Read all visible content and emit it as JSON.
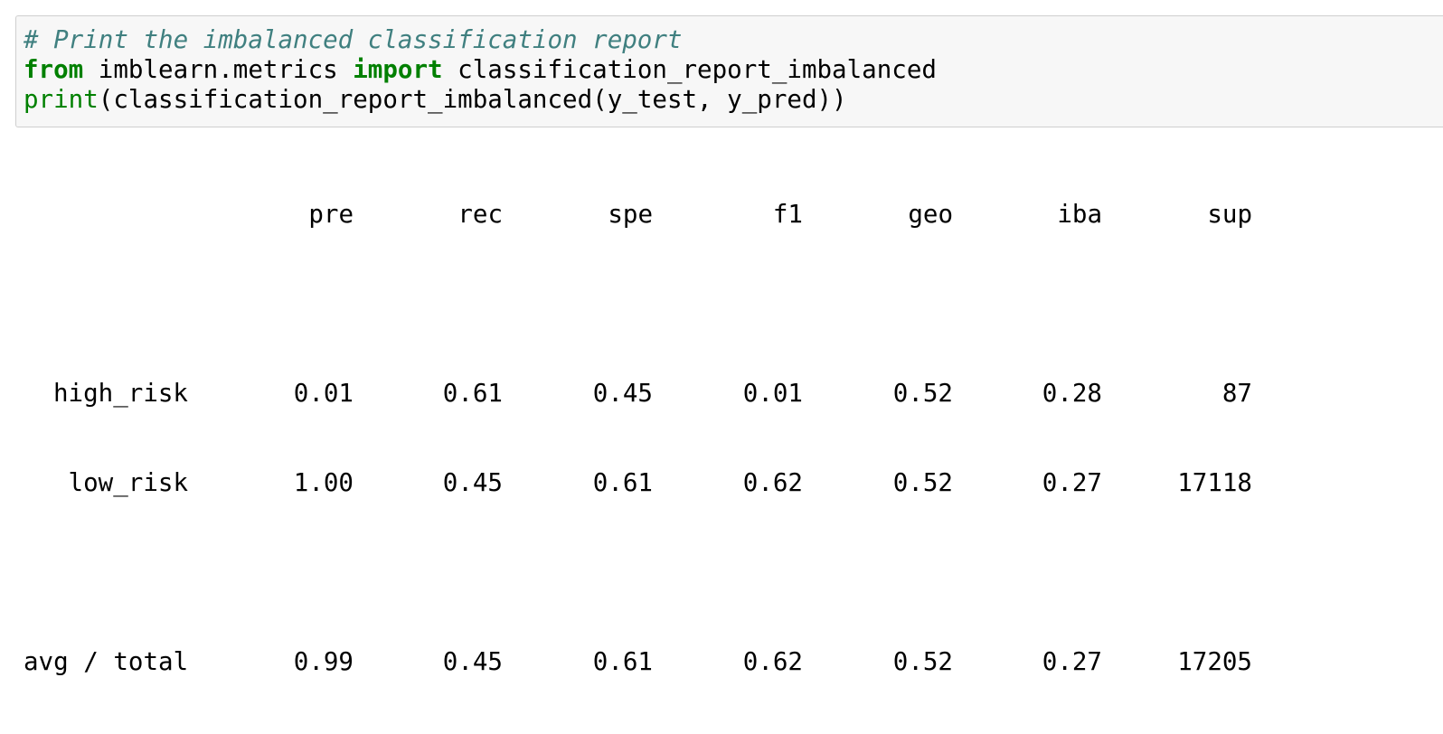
{
  "code_cell": {
    "comment": "# Print the imbalanced classification report",
    "line2_kw_from": "from",
    "line2_module": " imblearn.metrics ",
    "line2_kw_import": "import",
    "line2_name": " classification_report_imbalanced",
    "line3_builtin": "print",
    "line3_rest": "(classification_report_imbalanced(y_test, y_pred))"
  },
  "report": {
    "columns": [
      "pre",
      "rec",
      "spe",
      "f1",
      "geo",
      "iba",
      "sup"
    ],
    "rows": [
      {
        "label": "high_risk",
        "values": [
          "0.01",
          "0.61",
          "0.45",
          "0.01",
          "0.52",
          "0.28",
          "87"
        ]
      },
      {
        "label": "low_risk",
        "values": [
          "1.00",
          "0.45",
          "0.61",
          "0.62",
          "0.52",
          "0.27",
          "17118"
        ]
      }
    ],
    "total": {
      "label": "avg / total",
      "values": [
        "0.99",
        "0.45",
        "0.61",
        "0.62",
        "0.52",
        "0.27",
        "17205"
      ]
    }
  }
}
